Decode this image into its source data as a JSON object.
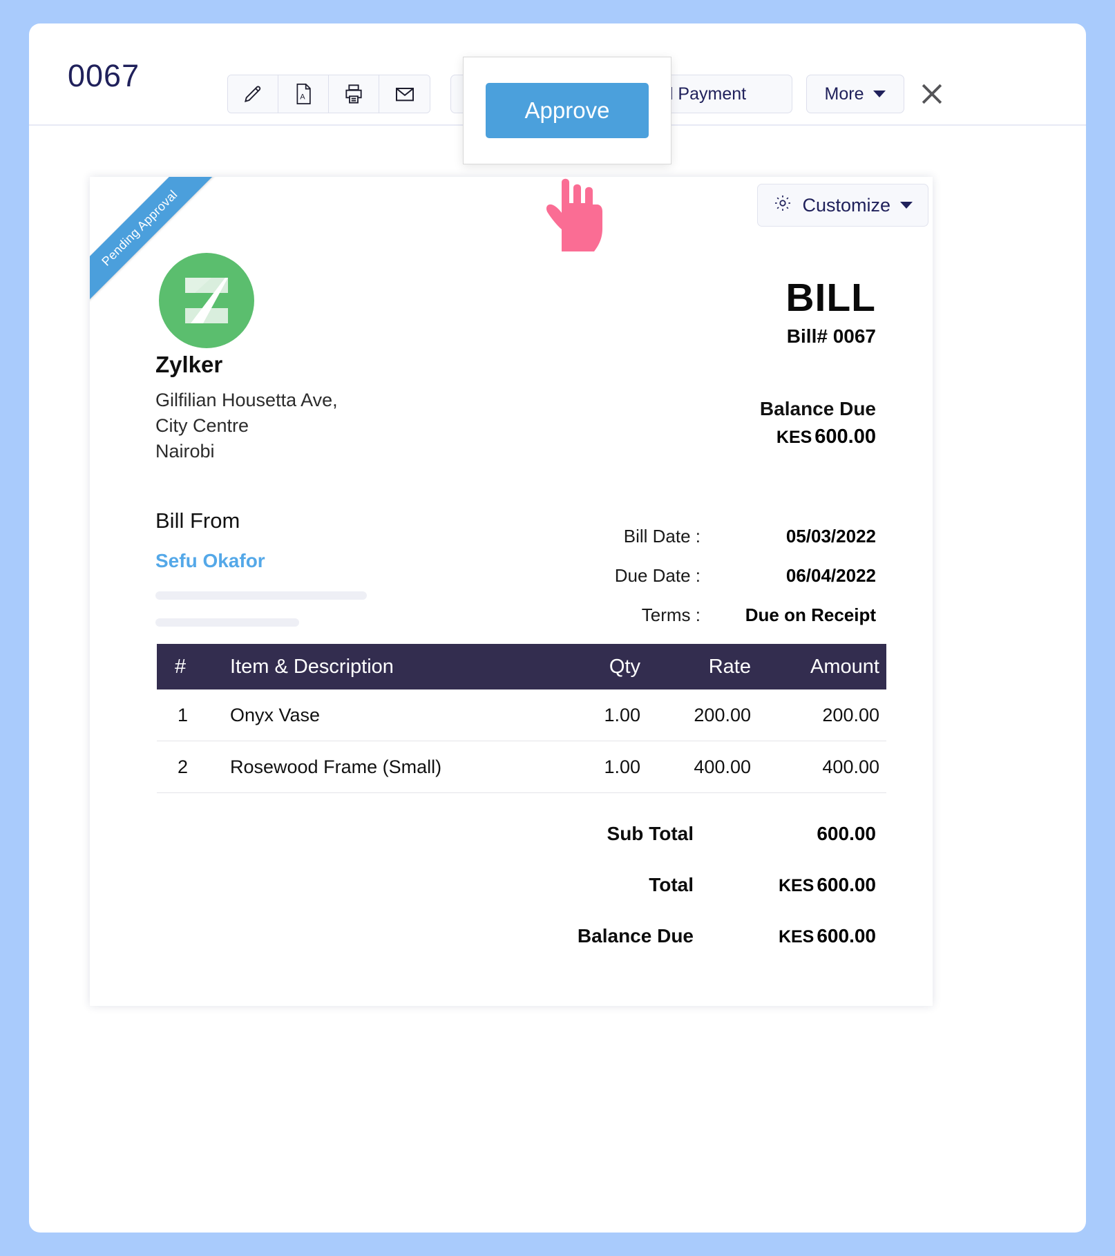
{
  "toolbar": {
    "record_number": "0067",
    "icon_buttons": [
      {
        "name": "edit-icon",
        "label": "Edit"
      },
      {
        "name": "pdf-icon",
        "label": "PDF"
      },
      {
        "name": "print-icon",
        "label": "Print"
      },
      {
        "name": "email-icon",
        "label": "Email"
      }
    ],
    "approve_button_label": "Approve",
    "record_payment_label": "Record Payment",
    "more_label": "More",
    "close_label": "Close"
  },
  "tooltip": {
    "approve_label": "Approve",
    "button_color": "#4BA0DC"
  },
  "document": {
    "status_ribbon": "Pending Approval",
    "ribbon_color": "#4B9FDC",
    "customize_label": "Customize",
    "logo_letter": "Z",
    "logo_color": "#5BBE6E",
    "company_name": "Zylker",
    "company_address": "Gilfilian Housetta Ave,\nCity Centre\nNairobi",
    "doc_type": "BILL",
    "doc_number_label": "Bill# 0067",
    "balance_due_label": "Balance Due",
    "balance_due_currency": "KES",
    "balance_due_amount": "600.00",
    "bill_from_label": "Bill From",
    "bill_from_name": "Sefu Okafor",
    "meta": [
      {
        "label": "Bill Date :",
        "value": "05/03/2022"
      },
      {
        "label": "Due Date :",
        "value": "06/04/2022"
      },
      {
        "label": "Terms :",
        "value": "Due on Receipt"
      }
    ],
    "table": {
      "headers": {
        "index": "#",
        "description": "Item & Description",
        "qty": "Qty",
        "rate": "Rate",
        "amount": "Amount"
      },
      "header_color": "#332D4F",
      "rows": [
        {
          "index": "1",
          "description": "Onyx Vase",
          "qty": "1.00",
          "rate": "200.00",
          "amount": "200.00"
        },
        {
          "index": "2",
          "description": "Rosewood Frame (Small)",
          "qty": "1.00",
          "rate": "400.00",
          "amount": "400.00"
        }
      ]
    },
    "totals": [
      {
        "label": "Sub Total",
        "currency": "",
        "value": "600.00"
      },
      {
        "label": "Total",
        "currency": "KES",
        "value": "600.00"
      },
      {
        "label": "Balance Due",
        "currency": "KES",
        "value": "600.00"
      }
    ]
  }
}
